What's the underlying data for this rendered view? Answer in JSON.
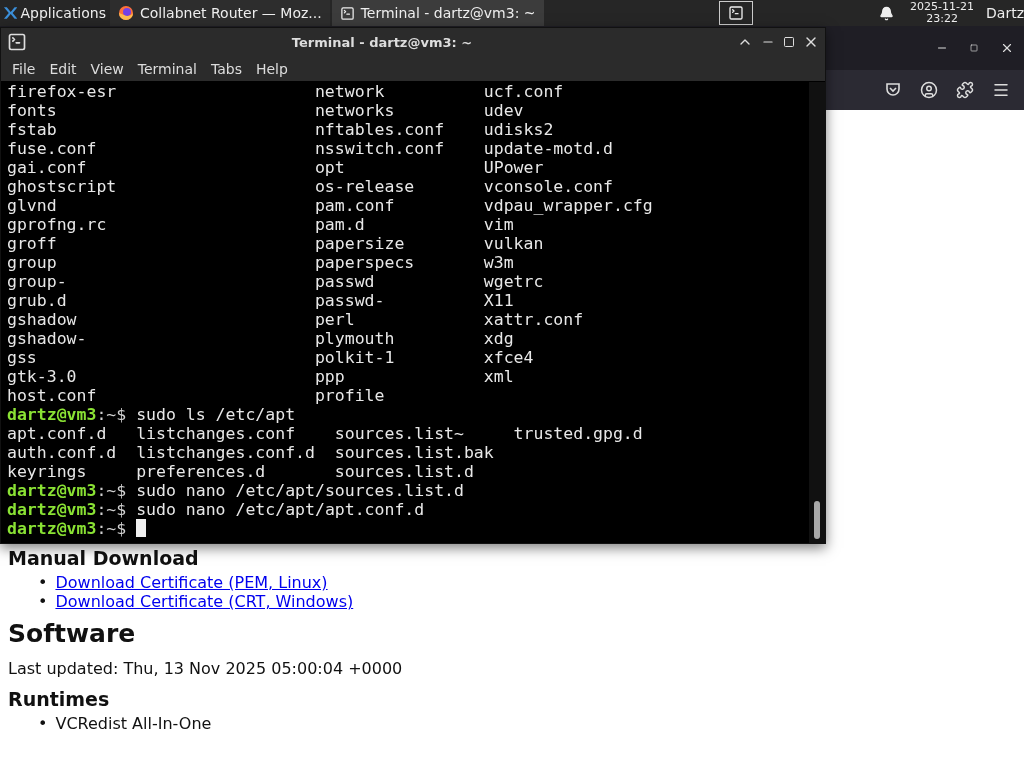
{
  "taskbar": {
    "menu_label": "Applications",
    "tasks": [
      {
        "label": "Collabnet Router — Moz...",
        "kind": "browser",
        "selected": false
      },
      {
        "label": "Terminal - dartz@vm3: ~",
        "kind": "terminal",
        "selected": true
      }
    ],
    "clock": {
      "date": "2025-11-21",
      "time": "23:22"
    },
    "user": "Dartz"
  },
  "terminal": {
    "title": "Terminal - dartz@vm3: ~",
    "menu": [
      "File",
      "Edit",
      "View",
      "Terminal",
      "Tabs",
      "Help"
    ],
    "lines": [
      {
        "kind": "listing",
        "cells": [
          "firefox-esr",
          "network",
          "ucf.conf"
        ]
      },
      {
        "kind": "listing",
        "cells": [
          "fonts",
          "networks",
          "udev"
        ]
      },
      {
        "kind": "listing",
        "cells": [
          "fstab",
          "nftables.conf",
          "udisks2"
        ]
      },
      {
        "kind": "listing",
        "cells": [
          "fuse.conf",
          "nsswitch.conf",
          "update-motd.d"
        ]
      },
      {
        "kind": "listing",
        "cells": [
          "gai.conf",
          "opt",
          "UPower"
        ]
      },
      {
        "kind": "listing",
        "cells": [
          "ghostscript",
          "os-release",
          "vconsole.conf"
        ]
      },
      {
        "kind": "listing",
        "cells": [
          "glvnd",
          "pam.conf",
          "vdpau_wrapper.cfg"
        ]
      },
      {
        "kind": "listing",
        "cells": [
          "gprofng.rc",
          "pam.d",
          "vim"
        ]
      },
      {
        "kind": "listing",
        "cells": [
          "groff",
          "papersize",
          "vulkan"
        ]
      },
      {
        "kind": "listing",
        "cells": [
          "group",
          "paperspecs",
          "w3m"
        ]
      },
      {
        "kind": "listing",
        "cells": [
          "group-",
          "passwd",
          "wgetrc"
        ]
      },
      {
        "kind": "listing",
        "cells": [
          "grub.d",
          "passwd-",
          "X11"
        ]
      },
      {
        "kind": "listing",
        "cells": [
          "gshadow",
          "perl",
          "xattr.conf"
        ]
      },
      {
        "kind": "listing",
        "cells": [
          "gshadow-",
          "plymouth",
          "xdg"
        ]
      },
      {
        "kind": "listing",
        "cells": [
          "gss",
          "polkit-1",
          "xfce4"
        ]
      },
      {
        "kind": "listing",
        "cells": [
          "gtk-3.0",
          "ppp",
          "xml"
        ]
      },
      {
        "kind": "listing",
        "cells": [
          "host.conf",
          "profile"
        ]
      },
      {
        "kind": "prompt",
        "user": "dartz@vm3",
        "path": ":~$",
        "command": "sudo ls /etc/apt",
        "cursor": false
      },
      {
        "kind": "listing_apt",
        "cells": [
          "apt.conf.d",
          "listchanges.conf",
          "sources.list~",
          "trusted.gpg.d"
        ]
      },
      {
        "kind": "listing_apt",
        "cells": [
          "auth.conf.d",
          "listchanges.conf.d",
          "sources.list.bak"
        ]
      },
      {
        "kind": "listing_apt",
        "cells": [
          "keyrings",
          "preferences.d",
          "sources.list.d"
        ]
      },
      {
        "kind": "prompt",
        "user": "dartz@vm3",
        "path": ":~$",
        "command": "sudo nano /etc/apt/sources.list.d",
        "cursor": false
      },
      {
        "kind": "prompt",
        "user": "dartz@vm3",
        "path": ":~$",
        "command": "sudo nano /etc/apt/apt.conf.d",
        "cursor": false
      },
      {
        "kind": "prompt",
        "user": "dartz@vm3",
        "path": ":~$",
        "cursor": true
      }
    ]
  },
  "browser": {
    "sections": [
      {
        "kind": "h3",
        "text": "Manual Download"
      },
      {
        "kind": "links",
        "marker": "•",
        "items": [
          "Download Certificate (PEM, Linux)",
          "Download Certificate (CRT, Windows)"
        ]
      },
      {
        "kind": "h2",
        "text": "Software"
      },
      {
        "kind": "para",
        "text": "Last updated: Thu, 13 Nov 2025 05:00:04 +0000"
      },
      {
        "kind": "h3",
        "text": "Runtimes"
      },
      {
        "kind": "bullets",
        "marker": "•",
        "items": [
          "VCRedist All-In-One"
        ]
      }
    ]
  }
}
